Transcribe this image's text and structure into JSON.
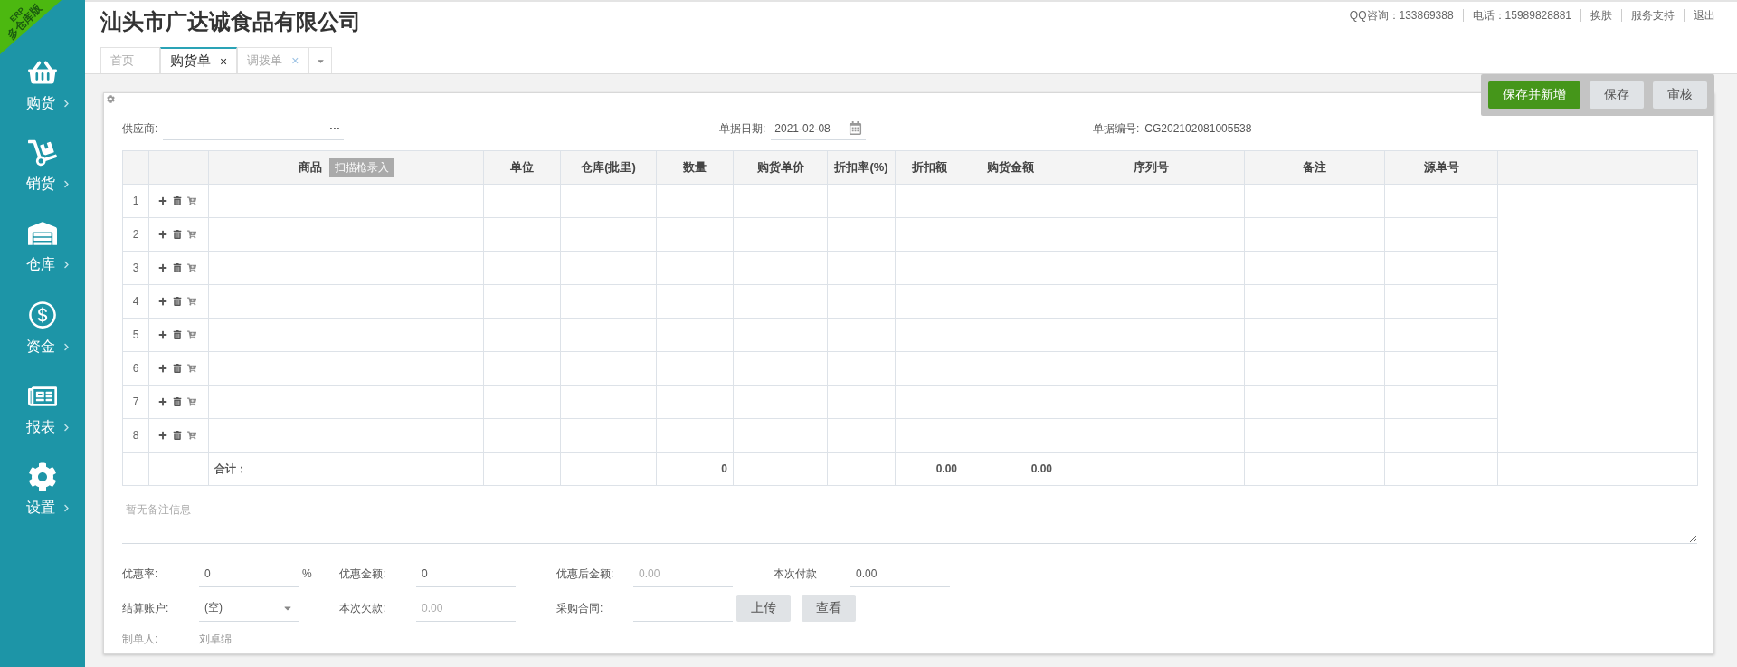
{
  "company": "汕头市广达诚食品有限公司",
  "ribbon": {
    "top": "ERP",
    "bottom": "多仓库版"
  },
  "top_links": [
    "QQ咨询：133869388",
    "电话：15989828881",
    "换肤",
    "服务支持",
    "退出"
  ],
  "sidebar": {
    "items": [
      {
        "label": "购货",
        "kind": "basket"
      },
      {
        "label": "销货",
        "kind": "truck"
      },
      {
        "label": "仓库",
        "kind": "warehouse"
      },
      {
        "label": "资金",
        "kind": "dollar"
      },
      {
        "label": "报表",
        "kind": "report"
      },
      {
        "label": "设置",
        "kind": "gear"
      }
    ]
  },
  "tabs": [
    {
      "label": "首页",
      "selected": false
    },
    {
      "label": "购货单",
      "selected": true,
      "close": "×"
    },
    {
      "label": "调拨单",
      "selected": false,
      "close": "×"
    }
  ],
  "actions": [
    {
      "label": "保存并新增",
      "kind": "primary"
    },
    {
      "label": "保存",
      "kind": "default"
    },
    {
      "label": "审核",
      "kind": "default"
    }
  ],
  "supplier": {
    "label": "供应商:",
    "more": "···"
  },
  "date": {
    "label": "单据日期:",
    "value": "2021-02-08"
  },
  "bill_no": {
    "label": "单据编号:",
    "value": "CG202102081005538"
  },
  "table": {
    "columns": [
      "",
      "",
      "商品",
      "单位",
      "仓库(批里)",
      "数量",
      "购货单价",
      "折扣率(%)",
      "折扣额",
      "购货金额",
      "序列号",
      "备注",
      "源单号"
    ],
    "scan_button": "扫描枪录入",
    "rows": [
      "1",
      "2",
      "3",
      "4",
      "5",
      "6",
      "7",
      "8"
    ],
    "total": {
      "label": "合计：",
      "quantity": "0",
      "discount": "0.00",
      "amount": "0.00"
    }
  },
  "remark": {
    "placeholder": "暂无备注信息"
  },
  "form": [
    [
      {
        "label": "优惠率:",
        "value": "0",
        "kind": "input",
        "suffix": "%"
      },
      {
        "label": "优惠金额:",
        "value": "0",
        "kind": "input"
      },
      {
        "label": "优惠后金额:",
        "value": "0.00",
        "kind": "readonly"
      },
      {
        "label": "本次付款",
        "value": "0.00",
        "kind": "input"
      }
    ],
    [
      {
        "label": "结算账户:",
        "value": "(空)",
        "kind": "select"
      },
      {
        "label": "本次欠款:",
        "value": "0.00",
        "kind": "readonly"
      },
      {
        "label": "采购合同:",
        "kind": "upload",
        "buttons": [
          "上传",
          "查看"
        ]
      }
    ],
    [
      {
        "label": "制单人:",
        "value": "刘卓绵",
        "kind": "text"
      }
    ]
  ]
}
